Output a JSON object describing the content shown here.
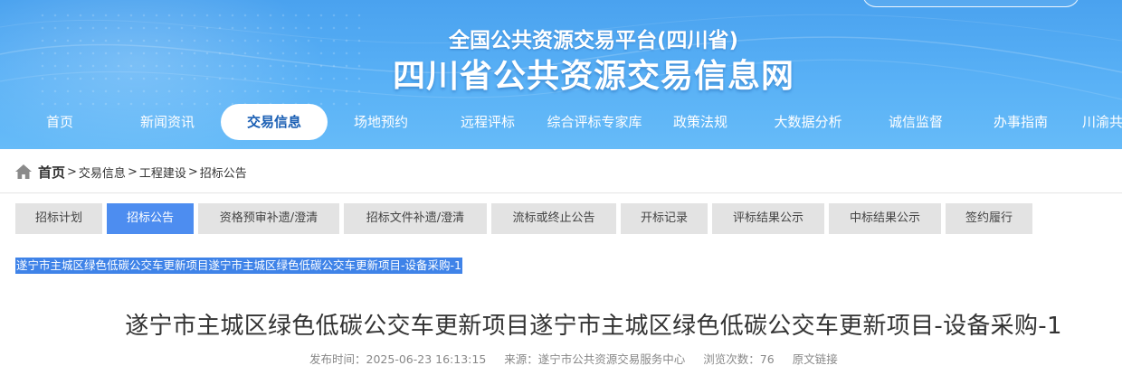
{
  "header": {
    "subtitle": "全国公共资源交易平台(四川省)",
    "title": "四川省公共资源交易信息网"
  },
  "nav": {
    "items": [
      {
        "label": "首页"
      },
      {
        "label": "新闻资讯"
      },
      {
        "label": "交易信息",
        "active": true
      },
      {
        "label": "场地预约"
      },
      {
        "label": "远程评标"
      },
      {
        "label": "综合评标专家库"
      },
      {
        "label": "政策法规"
      },
      {
        "label": "大数据分析"
      },
      {
        "label": "诚信监督"
      },
      {
        "label": "办事指南"
      },
      {
        "label": "川渝共"
      }
    ]
  },
  "breadcrumb": {
    "home": "首页",
    "separator": ">",
    "items": [
      "交易信息",
      "工程建设",
      "招标公告"
    ]
  },
  "tabs": {
    "items": [
      {
        "label": "招标计划"
      },
      {
        "label": "招标公告",
        "active": true
      },
      {
        "label": "资格预审补遗/澄清"
      },
      {
        "label": "招标文件补遗/澄清"
      },
      {
        "label": "流标或终止公告"
      },
      {
        "label": "开标记录"
      },
      {
        "label": "评标结果公示"
      },
      {
        "label": "中标结果公示"
      },
      {
        "label": "签约履行"
      }
    ]
  },
  "selection": {
    "text": "遂宁市主城区绿色低碳公交车更新项目遂宁市主城区绿色低碳公交车更新项目-设备采购-1"
  },
  "article": {
    "title": "遂宁市主城区绿色低碳公交车更新项目遂宁市主城区绿色低碳公交车更新项目-设备采购-1",
    "publish_label": "发布时间：",
    "publish_time": "2025-06-23 16:13:15",
    "source_label": "来源：",
    "source": "遂宁市公共资源交易服务中心",
    "views_label": "浏览次数：",
    "views": "76",
    "original_link": "原文链接"
  },
  "colors": {
    "banner": "#59b1f6",
    "tab_active": "#4d8df0",
    "tab_inactive": "#e3e3e3",
    "nav_active_text": "#1a5fb4",
    "selection": "#3f83e8"
  }
}
